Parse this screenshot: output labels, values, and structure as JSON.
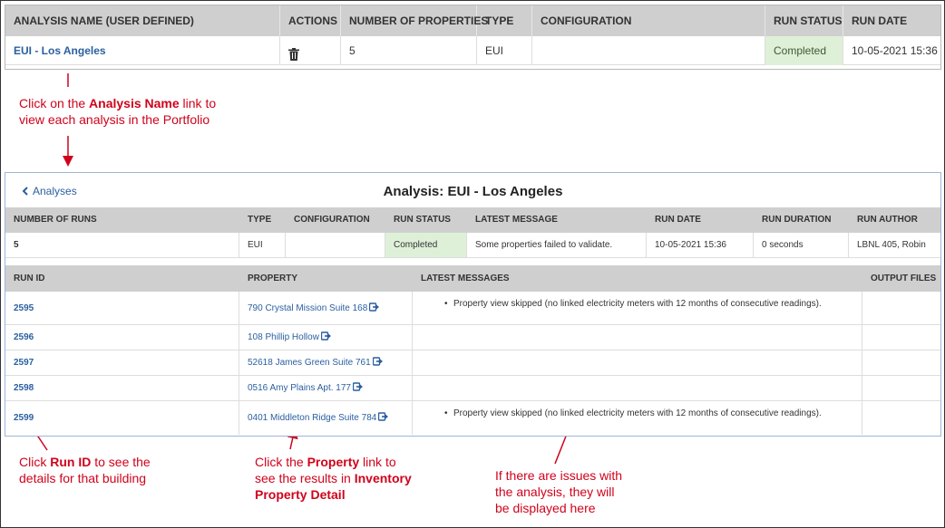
{
  "portfolio": {
    "headers": {
      "analysis_name": "ANALYSIS NAME (USER DEFINED)",
      "actions": "ACTIONS",
      "number_of_properties": "NUMBER OF PROPERTIES",
      "type": "TYPE",
      "configuration": "CONFIGURATION",
      "run_status": "RUN STATUS",
      "run_date": "RUN DATE"
    },
    "row": {
      "analysis_name": "EUI - Los Angeles",
      "number_of_properties": "5",
      "type": "EUI",
      "configuration": "",
      "run_status": "Completed",
      "run_date": "10-05-2021 15:36"
    }
  },
  "annotations": {
    "analysis_name_note": {
      "pre": "Click on the ",
      "bold": "Analysis Name",
      "post": " link to",
      "line2": "view each analysis in the Portfolio"
    },
    "run_id_note": {
      "pre": "Click ",
      "bold": "Run ID",
      "post": " to see the",
      "line2": "details for that building"
    },
    "property_note": {
      "pre": "Click the ",
      "bold": "Property",
      "post": " link to",
      "line2_pre": "see the results in ",
      "line2_bold": "Inventory",
      "line3_bold": "Property Detail"
    },
    "issues_note": {
      "line1": "If there are issues with",
      "line2": "the analysis, they will",
      "line3": "be displayed here"
    }
  },
  "analysis": {
    "back_label": "Analyses",
    "title": "Analysis: EUI - Los Angeles",
    "summary_headers": {
      "number_of_runs": "NUMBER OF RUNS",
      "type": "TYPE",
      "configuration": "CONFIGURATION",
      "run_status": "RUN STATUS",
      "latest_message": "LATEST MESSAGE",
      "run_date": "RUN DATE",
      "run_duration": "RUN DURATION",
      "run_author": "RUN AUTHOR"
    },
    "summary": {
      "number_of_runs": "5",
      "type": "EUI",
      "configuration": "",
      "run_status": "Completed",
      "latest_message": "Some properties failed to validate.",
      "run_date": "10-05-2021 15:36",
      "run_duration": "0 seconds",
      "run_author": "LBNL 405, Robin"
    },
    "runs_headers": {
      "run_id": "RUN ID",
      "property": "PROPERTY",
      "latest_messages": "LATEST MESSAGES",
      "output_files": "OUTPUT FILES"
    },
    "runs": [
      {
        "run_id": "2595",
        "property": "790 Crystal Mission Suite 168",
        "message": "Property view skipped (no linked electricity meters with 12 months of consecutive readings)."
      },
      {
        "run_id": "2596",
        "property": "108 Phillip Hollow",
        "message": ""
      },
      {
        "run_id": "2597",
        "property": "52618 James Green Suite 761",
        "message": ""
      },
      {
        "run_id": "2598",
        "property": "0516 Amy Plains Apt. 177",
        "message": ""
      },
      {
        "run_id": "2599",
        "property": "0401 Middleton Ridge Suite 784",
        "message": "Property view skipped (no linked electricity meters with 12 months of consecutive readings)."
      }
    ]
  },
  "icons": {
    "delete": "trash-icon",
    "back": "chevron-left-icon",
    "external": "external-link-icon"
  },
  "colors": {
    "link": "#2a5fa0",
    "annotation": "#d0021b",
    "completed_bg": "#dff0d8",
    "header_bg": "#cfcfcf"
  }
}
